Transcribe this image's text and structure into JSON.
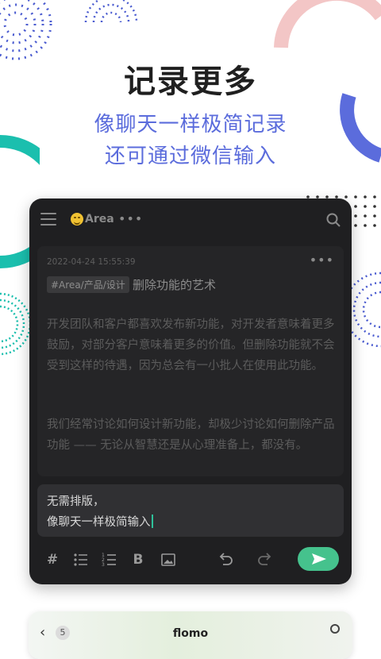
{
  "headline": {
    "title": "记录更多",
    "subtitle_line1": "像聊天一样极简记录",
    "subtitle_line2": "还可通过微信输入"
  },
  "app": {
    "topbar": {
      "workspace_emoji": "grinning-face-icon",
      "workspace_name": "Area",
      "more_label": "•••"
    },
    "note": {
      "timestamp": "2022-04-24 15:55:39",
      "more_label": "•••",
      "tag": "#Area/产品/设计",
      "title": "删除功能的艺术",
      "paragraph1": "开发团队和客户都喜欢发布新功能，对开发者意味着更多鼓励，对部分客户意味着更多的价值。但删除功能就不会受到这样的待遇，因为总会有一小批人在使用此功能。",
      "paragraph2": "我们经常讨论如何设计新功能，却极少讨论如何删除产品功能 —— 无论从智慧还是从心理准备上，都没有。"
    },
    "editor": {
      "line1": "无需排版，",
      "line2": "像聊天一样极简输入"
    },
    "toolbar": {
      "hash_label": "#",
      "bold_label": "B"
    }
  },
  "bottom_card": {
    "back_label": "‹",
    "badge": "5",
    "title": "flomo"
  },
  "colors": {
    "accent_blue": "#5b6cdc",
    "accent_green": "#45c28d",
    "teal": "#1bbfae",
    "pink": "#f3c6c6"
  }
}
